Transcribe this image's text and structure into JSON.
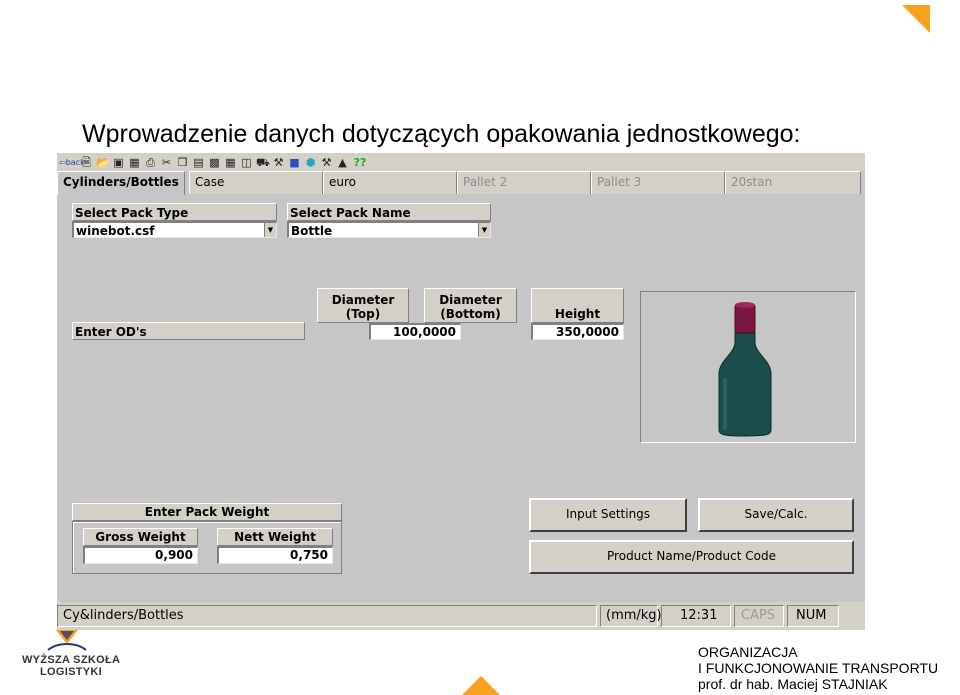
{
  "slide": {
    "title": "Wprowadzenie danych dotyczących opakowania jednostkowego:",
    "accent_color": "#f6a21e",
    "logo": {
      "line1": "WYŻSZA SZKOŁA",
      "line2": "LOGISTYKI"
    },
    "footer": {
      "line1": "ORGANIZACJA",
      "line2": "I FUNKCJONOWANIE TRANSPORTU",
      "line3": "prof. dr hab. Maciej STAJNIAK"
    }
  },
  "toolbar": {
    "back_label": "back",
    "help_label": "??",
    "icons": [
      "new-icon",
      "open-icon",
      "save-icon",
      "calc-icon",
      "print-icon",
      "scissors-icon",
      "copy-icon",
      "paste-icon",
      "pack-icon",
      "pallet-icon",
      "stack-icon",
      "truck-icon",
      "tool-icon",
      "cube-icon",
      "arrange-icon",
      "bottle-icon"
    ]
  },
  "tabs": [
    {
      "label": "Cylinders/Bottles",
      "state": "active"
    },
    {
      "label": "Case",
      "state": "normal"
    },
    {
      "label": "euro",
      "state": "normal"
    },
    {
      "label": "Pallet 2",
      "state": "disabled"
    },
    {
      "label": "Pallet 3",
      "state": "disabled"
    },
    {
      "label": "20stan",
      "state": "disabled"
    }
  ],
  "pack_type": {
    "label": "Select Pack Type",
    "value": "winebot.csf"
  },
  "pack_name": {
    "label": "Select Pack Name",
    "value": "Bottle"
  },
  "od": {
    "label": "Enter OD's",
    "diameter_top": {
      "label_line1": "Diameter",
      "label_line2": "(Top)"
    },
    "diameter_bottom": {
      "label_line1": "Diameter",
      "label_line2": "(Bottom)",
      "value": "100,0000"
    },
    "height": {
      "label": "Height",
      "value": "350,0000"
    }
  },
  "weight": {
    "label": "Enter Pack Weight",
    "gross": {
      "label": "Gross Weight",
      "value": "0,900"
    },
    "nett": {
      "label": "Nett Weight",
      "value": "0,750"
    }
  },
  "buttons": {
    "input_settings": "Input Settings",
    "save_calc": "Save/Calc.",
    "product_name": "Product Name/Product Code"
  },
  "bottle_colors": {
    "body": "#1b4d4d",
    "cap": "#7a1640"
  },
  "statusbar": {
    "section": "Cy&linders/Bottles",
    "units": "(mm/kg)",
    "time": "12:31",
    "caps": "CAPS",
    "num": "NUM"
  }
}
